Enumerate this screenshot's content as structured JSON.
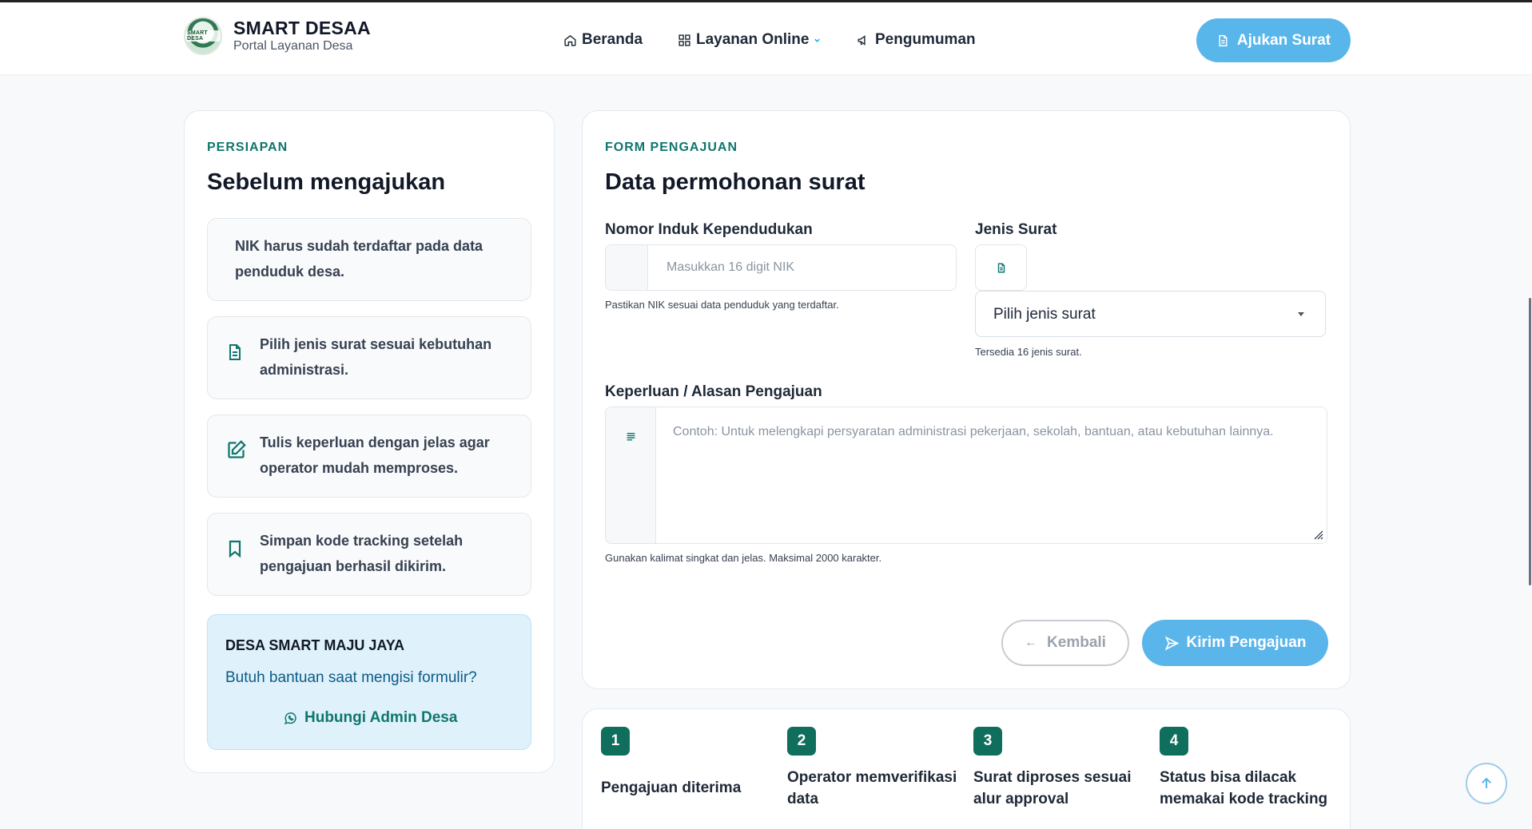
{
  "brand": {
    "logo_text": "SMART DESA",
    "title": "SMART DESAA",
    "subtitle": "Portal Layanan Desa"
  },
  "nav": {
    "home": "Beranda",
    "layanan": "Layanan Online",
    "pengumuman": "Pengumuman",
    "cta": "Ajukan Surat"
  },
  "left": {
    "eyebrow": "PERSIAPAN",
    "heading": "Sebelum mengajukan",
    "tips": [
      {
        "line1": "NIK harus sudah terdaftar pada data",
        "line2": "penduduk desa.",
        "icon": "none"
      },
      {
        "line1": "Pilih jenis surat sesuai kebutuhan",
        "line2": "administrasi.",
        "icon": "document-icon"
      },
      {
        "line1": "Tulis keperluan dengan jelas agar",
        "line2": "operator mudah memproses.",
        "icon": "edit-icon"
      },
      {
        "line1": "Simpan kode tracking setelah",
        "line2": "pengajuan berhasil dikirim.",
        "icon": "bookmark-icon"
      }
    ],
    "help": {
      "title": "DESA SMART MAJU JAYA",
      "subtitle": "Butuh bantuan saat mengisi formulir?",
      "link": "Hubungi Admin Desa"
    }
  },
  "form": {
    "eyebrow": "FORM PENGAJUAN",
    "heading": "Data permohonan surat",
    "nik": {
      "label": "Nomor Induk Kependudukan",
      "placeholder": "Masukkan 16 digit NIK",
      "hint": "Pastikan NIK sesuai data penduduk yang terdaftar."
    },
    "jenis": {
      "label": "Jenis Surat",
      "selected": "Pilih jenis surat",
      "hint": "Tersedia 16 jenis surat."
    },
    "keperluan": {
      "label": "Keperluan / Alasan Pengajuan",
      "placeholder": "Contoh: Untuk melengkapi persyaratan administrasi pekerjaan, sekolah, bantuan, atau kebutuhan lainnya.",
      "hint": "Gunakan kalimat singkat dan jelas. Maksimal 2000 karakter."
    },
    "back_label": "Kembali",
    "submit_label": "Kirim Pengajuan"
  },
  "steps": [
    {
      "num": "1",
      "text": "Pengajuan diterima"
    },
    {
      "num": "2",
      "text": "Operator memverifikasi data"
    },
    {
      "num": "3",
      "text": "Surat diproses sesuai alur approval"
    },
    {
      "num": "4",
      "text": "Status bisa dilacak memakai kode tracking"
    }
  ],
  "colors": {
    "accent": "#58b6ea",
    "primary_green": "#0f766e",
    "step_green": "#0f6e5c",
    "help_bg": "#dff1fb"
  }
}
